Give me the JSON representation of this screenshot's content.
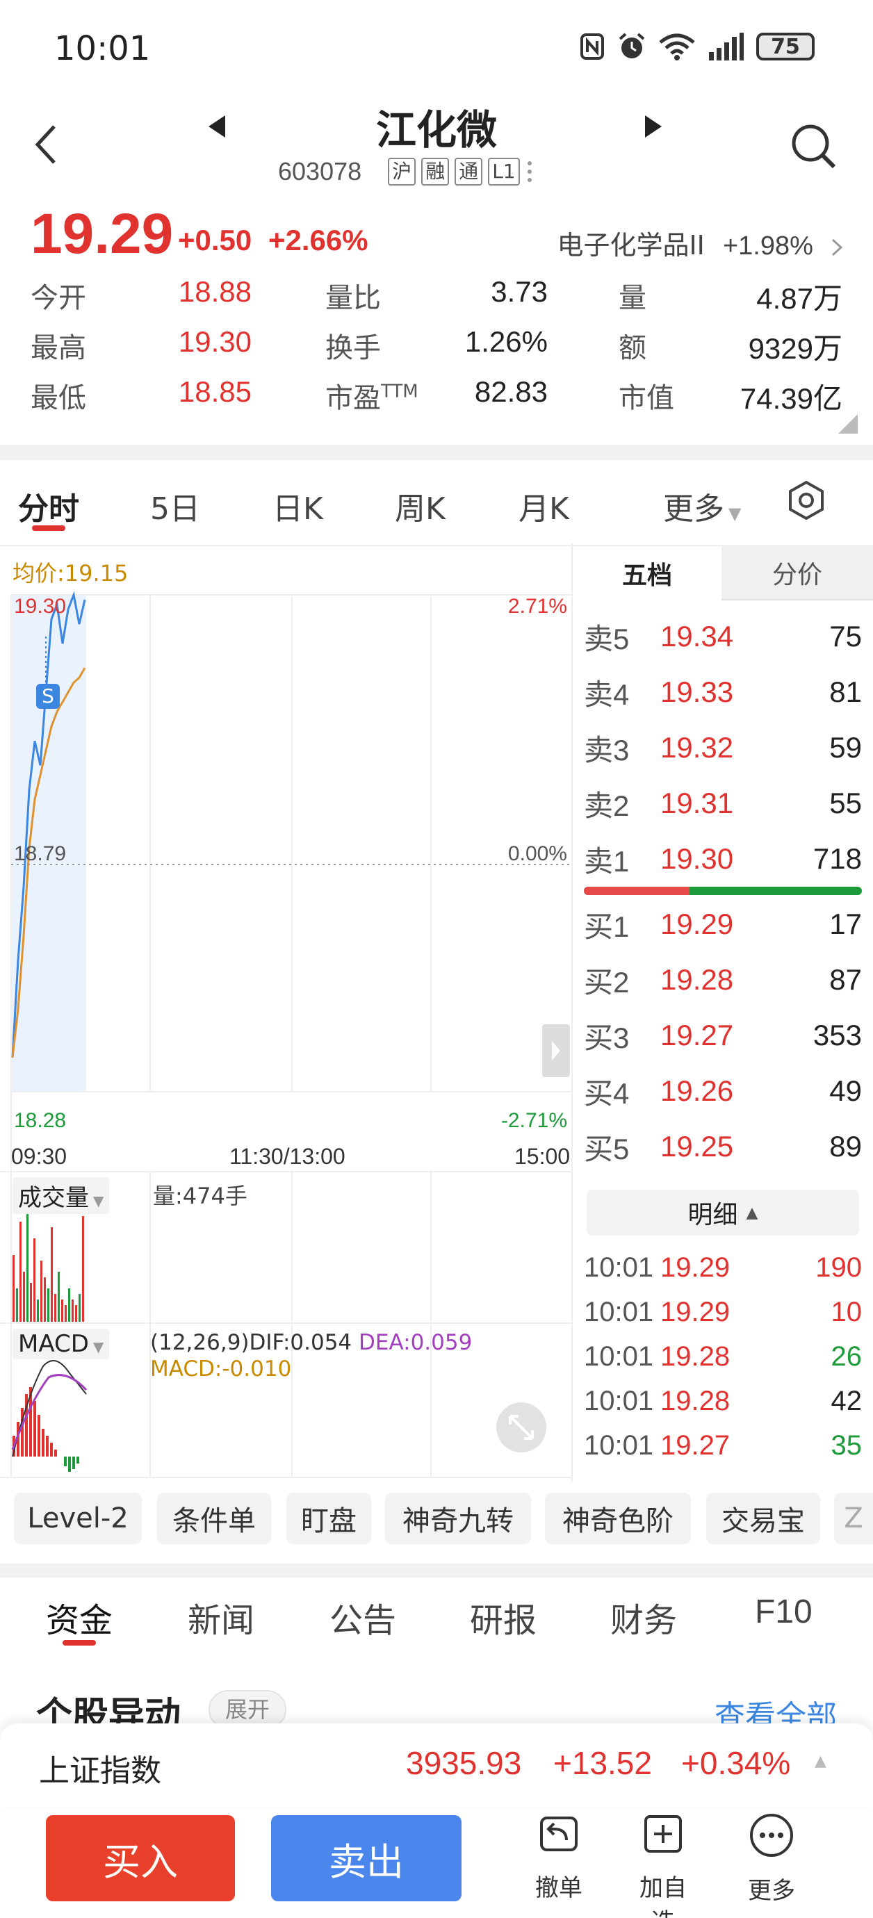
{
  "status_bar": {
    "time": "10:01",
    "battery": "75"
  },
  "header": {
    "title": "江化微",
    "code": "603078",
    "tags": [
      "沪",
      "融",
      "通",
      "L1"
    ]
  },
  "quote": {
    "price": "19.29",
    "change": "+0.50",
    "change_pct": "+2.66%",
    "sector": "电子化学品II",
    "sector_change": "+1.98%",
    "stats": [
      [
        {
          "label": "今开",
          "value": "18.88",
          "color": "red"
        },
        {
          "label": "量比",
          "value": "3.73",
          "color": "dark"
        },
        {
          "label": "量",
          "value": "4.87万",
          "color": "dark"
        }
      ],
      [
        {
          "label": "最高",
          "value": "19.30",
          "color": "red"
        },
        {
          "label": "换手",
          "value": "1.26%",
          "color": "dark"
        },
        {
          "label": "额",
          "value": "9329万",
          "color": "dark"
        }
      ],
      [
        {
          "label": "最低",
          "value": "18.85",
          "color": "red"
        },
        {
          "label": "市盈TTM",
          "value": "82.83",
          "color": "dark"
        },
        {
          "label": "市值",
          "value": "74.39亿",
          "color": "dark"
        }
      ]
    ]
  },
  "tabs": [
    "分时",
    "5日",
    "日K",
    "周K",
    "月K",
    "更多"
  ],
  "chart": {
    "avg_label": "均价:19.15",
    "y_high": "19.30",
    "y_mid": "18.79",
    "y_low": "18.28",
    "pct_high": "2.71%",
    "pct_mid": "0.00%",
    "pct_low": "-2.71%",
    "x_labels": [
      "09:30",
      "11:30/13:00",
      "15:00"
    ],
    "marker": "S",
    "vol_label": "成交量",
    "vol_value": "量:474手",
    "macd_label": "MACD",
    "macd_params": "(12,26,9)DIF:0.054",
    "macd_dea": "DEA:0.059",
    "macd_value": "MACD:-0.010"
  },
  "chart_data": {
    "type": "line",
    "series": [
      {
        "name": "price",
        "color": "#3a86e0",
        "values": [
          18.35,
          18.55,
          18.7,
          18.9,
          19.0,
          18.95,
          19.1,
          19.25,
          19.28,
          19.2,
          19.27,
          19.3,
          19.24,
          19.29
        ]
      },
      {
        "name": "avg",
        "color": "#e0922e",
        "values": [
          18.35,
          18.45,
          18.6,
          18.78,
          18.88,
          18.93,
          18.98,
          19.03,
          19.06,
          19.08,
          19.1,
          19.12,
          19.13,
          19.15
        ]
      }
    ],
    "ylim": [
      18.28,
      19.3
    ]
  },
  "order_book": {
    "tabs": [
      "五档",
      "分价"
    ],
    "sell": [
      {
        "label": "卖5",
        "price": "19.34",
        "vol": "75"
      },
      {
        "label": "卖4",
        "price": "19.33",
        "vol": "81"
      },
      {
        "label": "卖3",
        "price": "19.32",
        "vol": "59"
      },
      {
        "label": "卖2",
        "price": "19.31",
        "vol": "55"
      },
      {
        "label": "卖1",
        "price": "19.30",
        "vol": "718"
      }
    ],
    "buy": [
      {
        "label": "买1",
        "price": "19.29",
        "vol": "17"
      },
      {
        "label": "买2",
        "price": "19.28",
        "vol": "87"
      },
      {
        "label": "买3",
        "price": "19.27",
        "vol": "353"
      },
      {
        "label": "买4",
        "price": "19.26",
        "vol": "49"
      },
      {
        "label": "买5",
        "price": "19.25",
        "vol": "89"
      }
    ],
    "detail_label": "明细",
    "ticks": [
      {
        "time": "10:01",
        "price": "19.29",
        "vol": "190",
        "color": "red"
      },
      {
        "time": "10:01",
        "price": "19.29",
        "vol": "10",
        "color": "red"
      },
      {
        "time": "10:01",
        "price": "19.28",
        "vol": "26",
        "color": "green"
      },
      {
        "time": "10:01",
        "price": "19.28",
        "vol": "42",
        "color": "dark"
      },
      {
        "time": "10:01",
        "price": "19.27",
        "vol": "35",
        "color": "green"
      }
    ]
  },
  "chips": [
    "Level-2",
    "条件单",
    "盯盘",
    "神奇九转",
    "神奇色阶",
    "交易宝",
    "Z"
  ],
  "bottom_tabs": [
    "资金",
    "新闻",
    "公告",
    "研报",
    "财务",
    "F10"
  ],
  "section": {
    "title": "个股异动",
    "expand": "展开",
    "view_all": "查看全部"
  },
  "index": {
    "name": "上证指数",
    "value": "3935.93",
    "change": "+13.52",
    "pct": "+0.34%"
  },
  "actions": {
    "buy": "买入",
    "sell": "卖出",
    "tools": [
      "撤单",
      "加自选",
      "更多"
    ]
  }
}
